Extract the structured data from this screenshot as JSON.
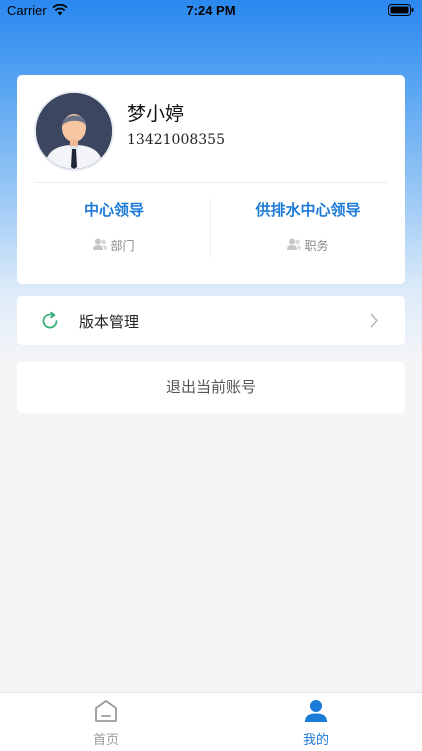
{
  "status_bar": {
    "carrier": "Carrier",
    "time": "7:24 PM"
  },
  "profile": {
    "name": "梦小婷",
    "phone": "13421008355",
    "department": {
      "value": "中心领导",
      "label": "部门"
    },
    "position": {
      "value": "供排水中心领导",
      "label": "职务"
    }
  },
  "menu": {
    "version_label": "版本管理"
  },
  "logout_label": "退出当前账号",
  "tabbar": {
    "home_label": "首页",
    "mine_label": "我的"
  },
  "colors": {
    "accent": "#1c7ad8",
    "header_blue": "#2a88ef",
    "refresh_green": "#3bb07a"
  },
  "icons": [
    "wifi-icon",
    "battery-icon",
    "avatar-icon",
    "person-icon",
    "refresh-icon",
    "chevron-right-icon",
    "home-icon",
    "user-icon"
  ]
}
